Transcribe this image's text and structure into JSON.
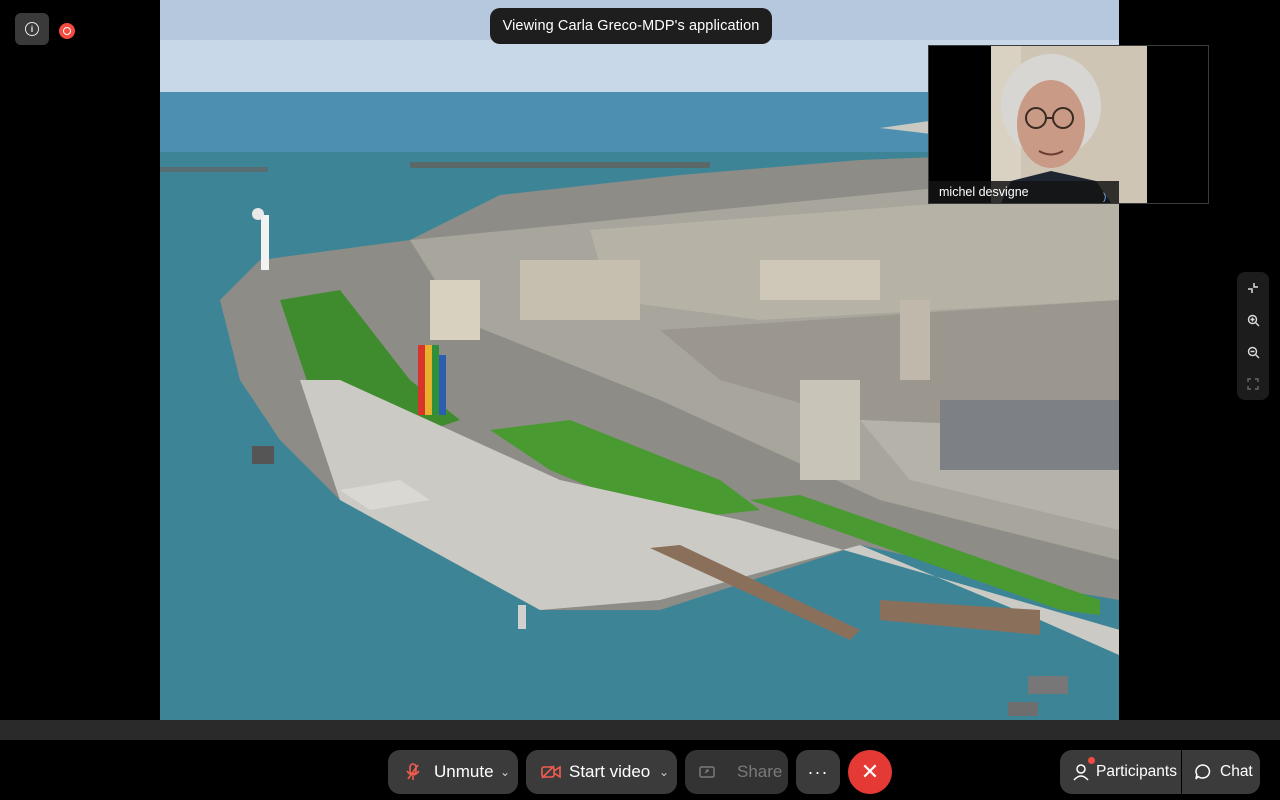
{
  "banner": {
    "text": "Viewing Carla Greco-MDP's application"
  },
  "participant_tile": {
    "name": "michel desvigne"
  },
  "controls": {
    "unmute_label": "Unmute",
    "start_video_label": "Start video",
    "share_label": "Share",
    "more_label": "···",
    "participants_label": "Participants",
    "chat_label": "Chat"
  },
  "icons": {
    "info": "info-icon",
    "recording": "recording-icon",
    "mic_muted": "mic-muted-icon",
    "video_off": "video-off-icon",
    "share": "share-screen-icon",
    "leave": "close-icon",
    "participants": "person-icon",
    "chat": "chat-bubble-icon",
    "zoom": [
      "collapse-icon",
      "zoom-in-icon",
      "zoom-out-icon",
      "fullscreen-icon"
    ]
  },
  "colors": {
    "leave_red": "#e53935",
    "recording_red": "#f24b3f",
    "muted_icon": "#f25c4f",
    "pill_bg": "#3b3b3b"
  }
}
